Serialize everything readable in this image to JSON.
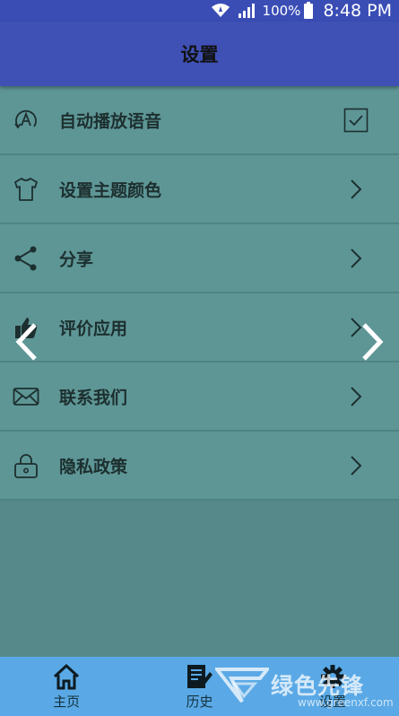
{
  "status_bar": {
    "battery_percent": "100%",
    "time": "8:48 PM"
  },
  "header": {
    "title": "设置"
  },
  "settings": {
    "items": [
      {
        "label": "自动播放语音",
        "icon": "auto-play-voice-icon",
        "trailing": "checkbox",
        "checked": true
      },
      {
        "label": "设置主题颜色",
        "icon": "tshirt-icon",
        "trailing": "chevron"
      },
      {
        "label": "分享",
        "icon": "share-icon",
        "trailing": "chevron"
      },
      {
        "label": "评价应用",
        "icon": "thumbs-up-icon",
        "trailing": "chevron"
      },
      {
        "label": "联系我们",
        "icon": "mail-icon",
        "trailing": "chevron"
      },
      {
        "label": "隐私政策",
        "icon": "lock-icon",
        "trailing": "chevron"
      }
    ]
  },
  "bottom_nav": {
    "items": [
      {
        "label": "主页",
        "icon": "home-icon"
      },
      {
        "label": "历史",
        "icon": "history-icon"
      },
      {
        "label": "设置",
        "icon": "gear-icon"
      }
    ]
  },
  "watermark": {
    "text": "绿色先锋",
    "url": "www.greenxf.com"
  },
  "colors": {
    "status_bar": "#3a4db5",
    "header": "#3f51b5",
    "list_background": "#5e9696",
    "page_background": "#568a8a",
    "bottom_nav": "#5aa9e6"
  }
}
